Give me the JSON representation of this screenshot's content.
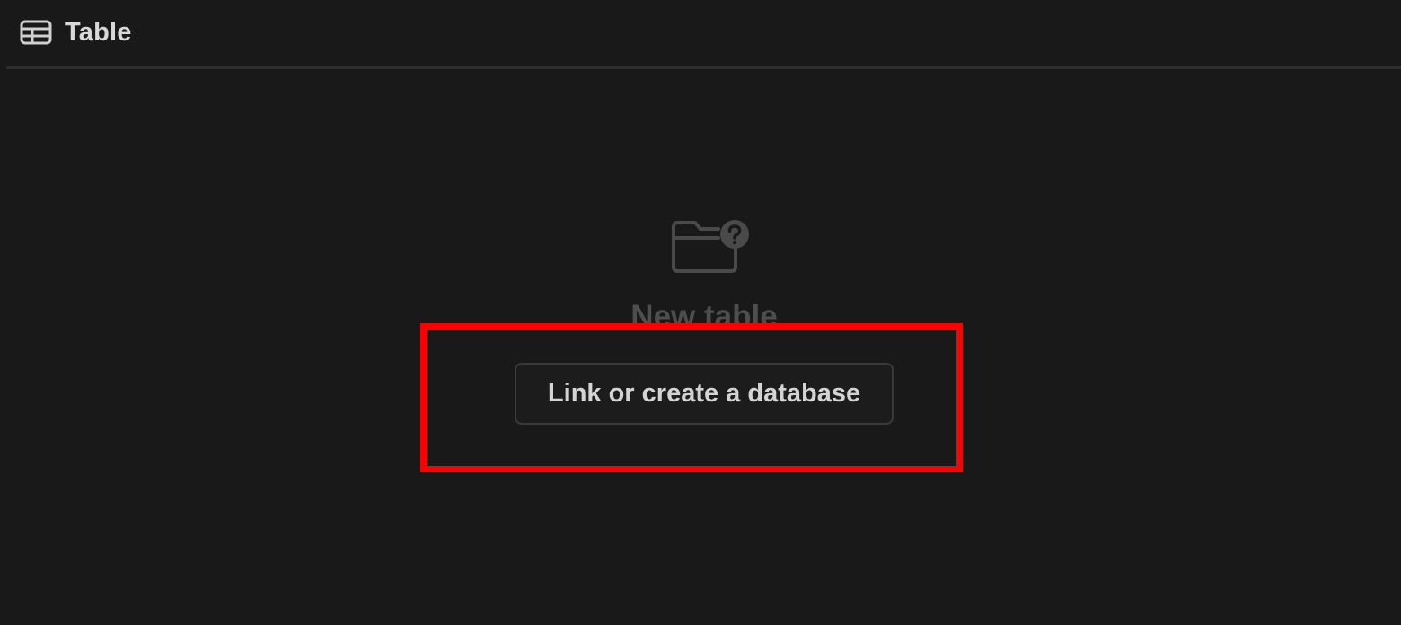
{
  "header": {
    "icon": "table-icon",
    "title": "Table"
  },
  "empty_state": {
    "icon": "folder-question-icon",
    "title": "New table",
    "action_label": "Link or create a database"
  },
  "annotation": {
    "highlight_color": "#ff0000"
  },
  "colors": {
    "background": "#191919",
    "divider": "#2d2d2d",
    "text_primary": "#d8d8d8",
    "text_muted": "#4e4e4e",
    "button_border": "#3a3a3a"
  }
}
